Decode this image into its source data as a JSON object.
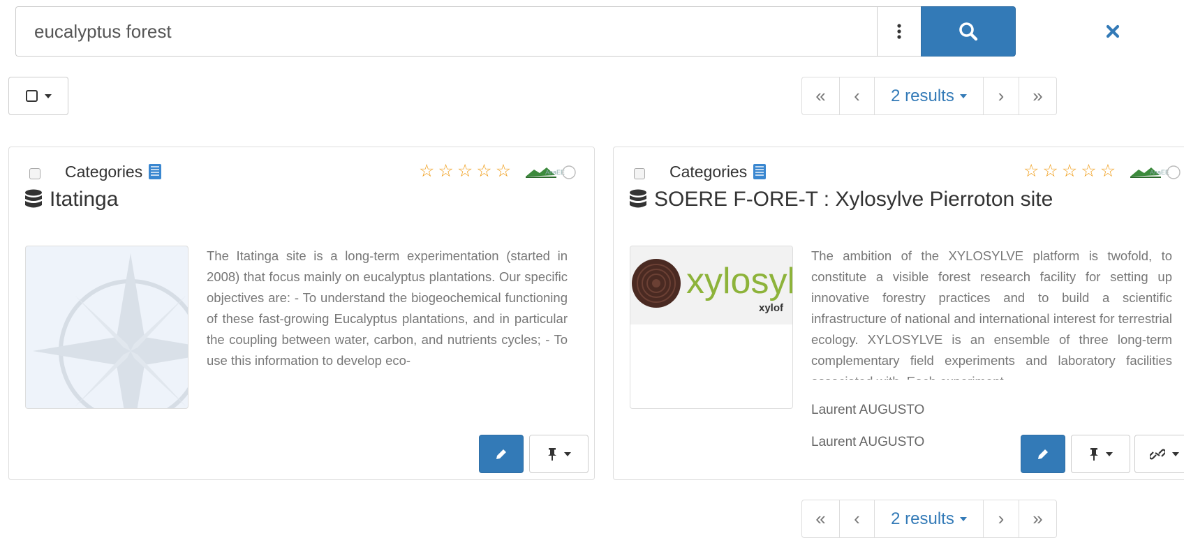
{
  "search": {
    "value": "eucalyptus forest",
    "placeholder": ""
  },
  "pagination": {
    "results_label": "2 results",
    "first": "«",
    "prev": "‹",
    "next": "›",
    "last": "»"
  },
  "cards": [
    {
      "categories_label": "Categories",
      "title": "Itatinga",
      "rating_stars": 5,
      "rating_filled": 0,
      "description": "The Itatinga site is a long-term experimentation (started in 2008) that focus mainly on eucalyptus plantations. Our specific objectives are: - To understand the biogeochemical functioning of these fast-growing Eucalyptus plantations, and in particular the coupling between water, carbon, and nutrients cycles; - To use this information to develop eco-",
      "thumbnail": "compass-rose-placeholder"
    },
    {
      "categories_label": "Categories",
      "title": "SOERE F-ORE-T : Xylosylve Pierroton site",
      "rating_stars": 5,
      "rating_filled": 0,
      "description": "The ambition of the XYLOSYLVE platform is twofold, to constitute a visible forest research facility for setting up innovative forestry practices and to build a scientific infrastructure of national and international interest for terrestrial ecology. XYLOSYLVE is an ensemble of three long-term complementary field experiments and laboratory facilities associated with. Each experiment",
      "thumbnail_logo_text": "xylosylv",
      "thumbnail_logo_subtext": "xylof",
      "contacts": [
        "Laurent AUGUSTO",
        "Laurent AUGUSTO"
      ]
    }
  ],
  "colors": {
    "primary": "#337ab7",
    "star": "#f0a020",
    "logo_green": "#8db33a"
  }
}
